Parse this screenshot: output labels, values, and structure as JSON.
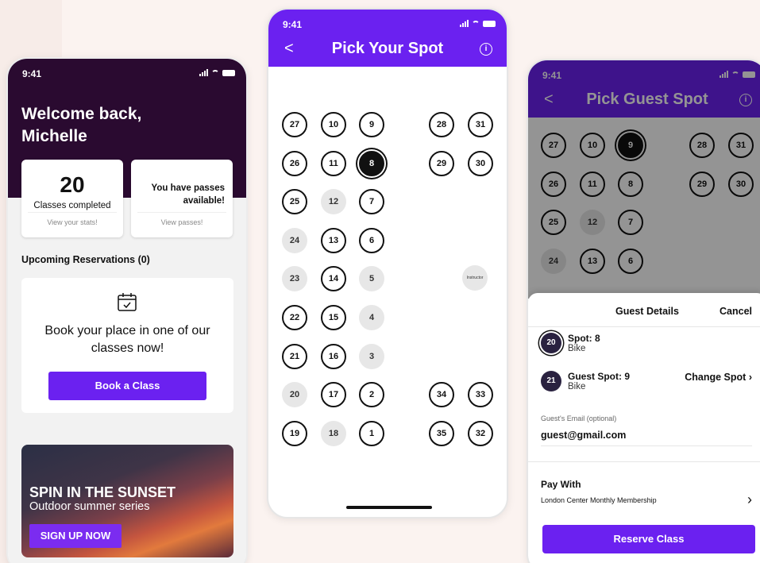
{
  "status_time": "9:41",
  "phone1": {
    "welcome": "Welcome back, Michelle",
    "classes_count": "20",
    "classes_label": "Classes completed",
    "classes_link": "View your stats!",
    "passes_label": "You have passes available!",
    "passes_link": "View passes!",
    "upcoming": "Upcoming Reservations (0)",
    "book_text": "Book your place in one of our classes now!",
    "book_button": "Book a Class",
    "promo_title": "SPIN IN THE SUNSET",
    "promo_sub": "Outdoor summer series",
    "promo_button": "SIGN UP NOW"
  },
  "phone2": {
    "back": "<",
    "title": "Pick Your Spot",
    "info": "i",
    "selected": "8",
    "disabled": [
      "12",
      "24",
      "23",
      "5",
      "4",
      "3",
      "20",
      "18"
    ],
    "instructor": "Instructor",
    "spots_left": [
      [
        "27",
        "10",
        "9"
      ],
      [
        "26",
        "11",
        "8"
      ],
      [
        "25",
        "12",
        "7"
      ],
      [
        "24",
        "13",
        "6"
      ],
      [
        "23",
        "14",
        "5"
      ],
      [
        "22",
        "15",
        "4"
      ],
      [
        "21",
        "16",
        "3"
      ],
      [
        "20",
        "17",
        "2"
      ],
      [
        "19",
        "18",
        "1"
      ]
    ],
    "spots_right_top": [
      [
        "28",
        "31"
      ],
      [
        "29",
        "30"
      ]
    ],
    "spots_right_bottom": [
      [
        "34",
        "33"
      ],
      [
        "35",
        "32"
      ]
    ]
  },
  "phone3": {
    "back": "<",
    "title": "Pick Guest Spot",
    "info": "i",
    "selected": "9",
    "disabled": [
      "12",
      "24"
    ],
    "spots_left": [
      [
        "27",
        "10",
        "9"
      ],
      [
        "26",
        "11",
        "8"
      ],
      [
        "25",
        "12",
        "7"
      ],
      [
        "24",
        "13",
        "6"
      ]
    ],
    "spots_right": [
      [
        "28",
        "31"
      ],
      [
        "29",
        "30"
      ]
    ],
    "sheet_title": "Guest Details",
    "cancel": "Cancel",
    "my_badge": "20",
    "my_spot": "Spot: 8",
    "my_type": "Bike",
    "guest_badge": "21",
    "guest_spot": "Guest Spot: 9",
    "guest_type": "Bike",
    "change_spot": "Change Spot",
    "email_label": "Guest's Email (optional)",
    "email_value": "guest@gmail.com",
    "pay_with": "Pay With",
    "membership": "London Center Monthly Membership",
    "reserve": "Reserve Class"
  },
  "colors": {
    "purple": "#6b21f0",
    "dark": "#2a0a30"
  }
}
